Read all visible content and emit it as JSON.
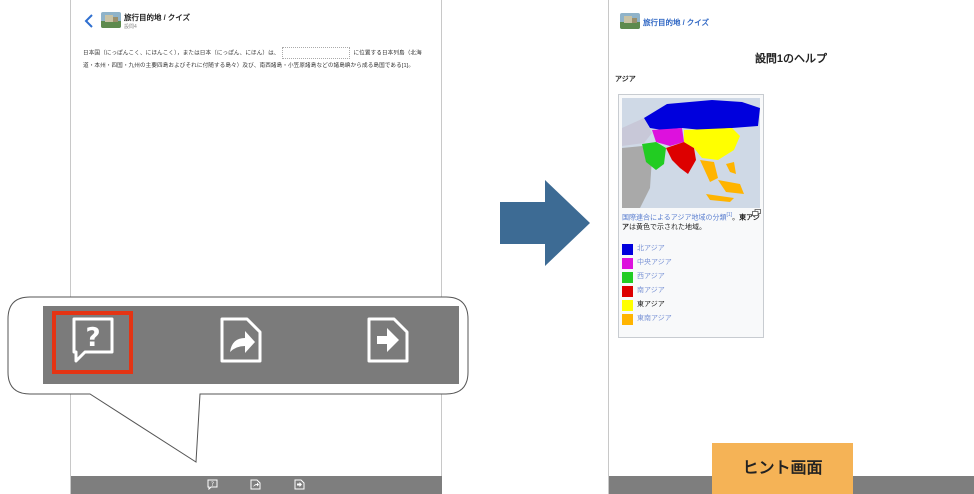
{
  "left": {
    "title": "旅行目的地 / クイズ",
    "subtitle": "設問4",
    "body_before": "日本国（にっぽんこく、にほんこく），または日本（にっぽん、にほん）は、",
    "body_after": "に位置する日本列島（北海道・本州・四国・九州の主要四島およびそれに付随する島々）及び、南西諸島・小笠原諸島などの諸島嶼から成る島国である[1]。"
  },
  "toolbar": {
    "help_icon": "help-question-icon",
    "share_icon": "share-arrow-icon",
    "next_icon": "next-arrow-icon",
    "bg_color": "#7b7b7b",
    "highlight_color": "#e43414"
  },
  "right": {
    "title": "旅行目的地 / クイズ",
    "help_title": "設問1のヘルプ",
    "section_heading": "アジア",
    "caption_link": "国際連合によるアジア地域の分類",
    "caption_ref": "[1]",
    "caption_bold": "東アジア",
    "caption_rest": "は黄色で示された地域。",
    "legend": [
      {
        "label": "北アジア",
        "color": "#0000dd",
        "linked": true
      },
      {
        "label": "中央アジア",
        "color": "#dd11dd",
        "linked": true
      },
      {
        "label": "西アジア",
        "color": "#22cc22",
        "linked": true
      },
      {
        "label": "南アジア",
        "color": "#dd0000",
        "linked": true
      },
      {
        "label": "東アジア",
        "color": "#ffff00",
        "linked": false
      },
      {
        "label": "東南アジア",
        "color": "#ffb400",
        "linked": true
      }
    ]
  },
  "hint_label": "ヒント画面",
  "arrow_color": "#3d6b94"
}
